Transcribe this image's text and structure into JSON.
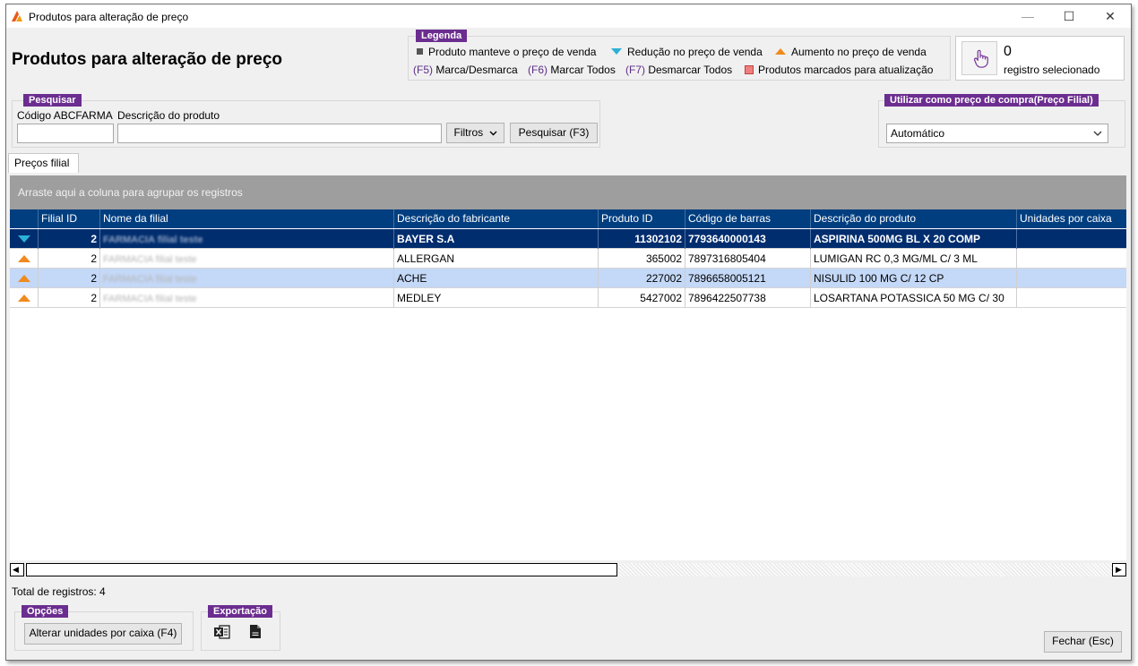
{
  "window": {
    "title": "Produtos para alteração de preço",
    "min_glyph": "—",
    "max_glyph": "☐",
    "close_glyph": "✕"
  },
  "page_title": "Produtos para alteração de preço",
  "legend": {
    "title": "Legenda",
    "maintained": "Produto manteve o preço de venda",
    "reduction": "Redução no preço de venda",
    "increase": "Aumento no preço de venda",
    "f5_key": "(F5)",
    "f5_label": "Marca/Desmarca",
    "f6_key": "(F6)",
    "f6_label": "Marcar Todos",
    "f7_key": "(F7)",
    "f7_label": "Desmarcar Todos",
    "marked": "Produtos marcados para atualização",
    "colors": {
      "maintained": "#555555",
      "reduction": "#2bb0d6",
      "increase": "#f08a1c",
      "marked": "#f08080"
    }
  },
  "selection": {
    "icon": "pointer-hand-icon",
    "count": "0",
    "label": "registro selecionado"
  },
  "search": {
    "title": "Pesquisar",
    "code_label": "Código ABCFARMA",
    "code_value": "",
    "desc_label": "Descrição do produto",
    "desc_value": "",
    "filters_button": "Filtros",
    "search_button": "Pesquisar (F3)"
  },
  "purchase_price": {
    "title": "Utilizar como preço de compra(Preço Filial)",
    "selected": "Automático"
  },
  "tabs": [
    {
      "label": "Preços filial",
      "active": true
    }
  ],
  "group_by_hint": "Arraste aqui a coluna para agrupar os registros",
  "columns": [
    "Filial ID",
    "Nome da filial",
    "Descrição do fabricante",
    "Produto ID",
    "Código de barras",
    "Descrição do produto",
    "Unidades por caixa"
  ],
  "rows": [
    {
      "indicator": "down",
      "filial_id": "2",
      "filial_name": "FARMACIA filial teste",
      "manufacturer": "BAYER S.A",
      "product_id": "11302102",
      "barcode": "7793640000143",
      "product": "ASPIRINA 500MG BL X 20 COMP",
      "units": "",
      "selected": true
    },
    {
      "indicator": "up",
      "filial_id": "2",
      "filial_name": "FARMACIA filial teste",
      "manufacturer": "ALLERGAN",
      "product_id": "365002",
      "barcode": "7897316805404",
      "product": "LUMIGAN RC 0,3 MG/ML C/ 3 ML",
      "units": ""
    },
    {
      "indicator": "up",
      "filial_id": "2",
      "filial_name": "FARMACIA filial teste",
      "manufacturer": "ACHE",
      "product_id": "227002",
      "barcode": "7896658005121",
      "product": "NISULID 100 MG C/ 12 CP",
      "units": "",
      "highlight": true
    },
    {
      "indicator": "up",
      "filial_id": "2",
      "filial_name": "FARMACIA filial teste",
      "manufacturer": "MEDLEY",
      "product_id": "5427002",
      "barcode": "7896422507738",
      "product": "LOSARTANA POTASSICA 50 MG C/ 30",
      "units": ""
    }
  ],
  "scrollbar": {
    "left_arrow": "◀",
    "right_arrow": "▶"
  },
  "total_label": "Total de registros: 4",
  "options": {
    "title": "Opções",
    "change_units_button": "Alterar unidades por caixa (F4)"
  },
  "export": {
    "title": "Exportação",
    "excel_icon": "excel-export-icon",
    "file_icon": "file-export-icon"
  },
  "close_button": "Fechar (Esc)"
}
